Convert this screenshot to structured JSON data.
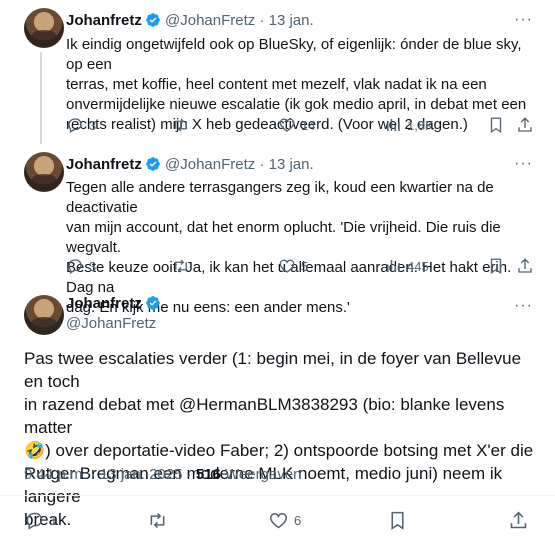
{
  "tweet1": {
    "name": "Johanfretz",
    "handle": "@JohanFretz",
    "sep": "·",
    "date": "13 jan.",
    "more": "···",
    "lines": [
      "Ik eindig ongetwijfeld ook op BlueSky, of eigenlijk: ónder de blue sky, op een",
      "terras, met koffie, heel content met mezelf, vlak nadat ik na een",
      "onvermijdelijke nieuwe escalatie (ik gok medio april, in debat met een",
      "rechts realist) mijn X heb gedeactiveerd. (Voor wel 2 dagen.)"
    ],
    "replies": "3",
    "likes": "14",
    "views": "1,8K"
  },
  "tweet2": {
    "name": "Johanfretz",
    "handle": "@JohanFretz",
    "sep": "·",
    "date": "13 jan.",
    "more": "···",
    "lines": [
      "Tegen alle andere terrasgangers zeg ik, koud een kwartier na de deactivatie",
      "van mijn account, dat het enorm oplucht. 'Die vrijheid. Die ruis die wegvalt.",
      "Beste keuze ooit. Ja, ik kan het u allemaal aanraden. Het hakt erin. Dag na",
      "dag. En kijk me nu eens: een ander mens.'"
    ],
    "replies": "3",
    "likes": "5",
    "views": "445"
  },
  "main": {
    "name": "Johanfretz",
    "handle": "@JohanFretz",
    "more": "···",
    "lines": [
      "Pas twee escalaties verder (1: begin mei, in de foyer van Bellevue en toch",
      "in razend debat met @HermanBLM3838293 (bio: blanke levens matter",
      "🤣) over deportatie-video Faber; 2) ontspoorde botsing met X'er die",
      "Rutger Bregman een moderne MLK noemt, medio juni) neem ik langere",
      "break."
    ],
    "time": "9:44 p.m.",
    "sep": "·",
    "date": "13 jan. 2025",
    "views_count": "516",
    "views_label": "Weergaven",
    "replies": "1",
    "likes": "6"
  },
  "colors": {
    "verified": "#1d9bf0",
    "text": "#0f1419",
    "muted": "#536471"
  }
}
